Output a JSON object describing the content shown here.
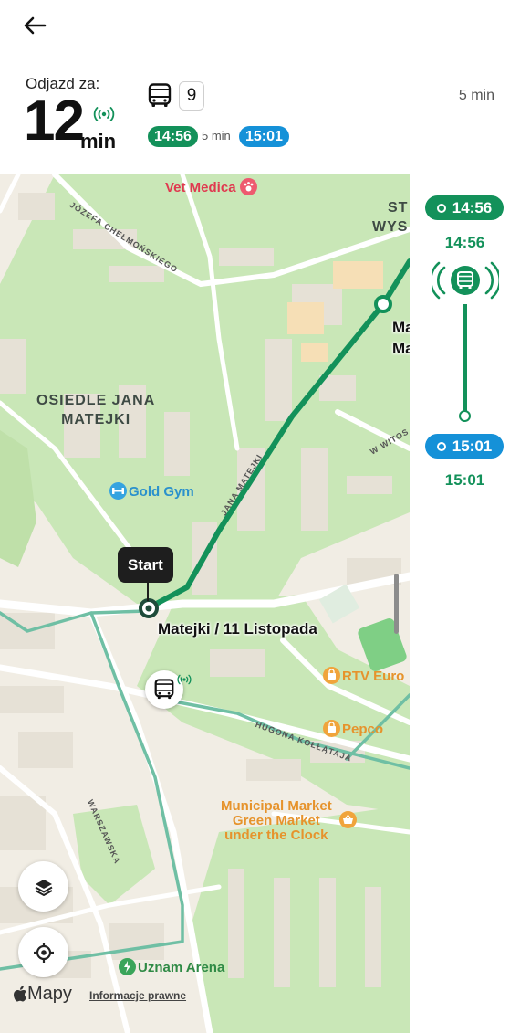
{
  "header": {
    "depart_label": "Odjazd za:",
    "depart_minutes": "12",
    "depart_unit": "min",
    "line_number": "9",
    "departure_time": "14:56",
    "duration": "5 min",
    "arrival_time": "15:01",
    "duration_right": "5 min"
  },
  "map": {
    "labels": {
      "district": "OSIEDLE JANA\nMATEJKI",
      "district_right_1": "ST\nWYS",
      "street_chelmonskiego": "JÓZEFA CHEŁMOŃSKIEGO",
      "street_matejki": "JANA MATEJKI",
      "street_witos": "W WITOS",
      "street_kollataja": "HUGONA KOŁŁĄTAJA",
      "street_warszawska": "WARSZAWSKA",
      "stop_right": "Ma\nMa",
      "poi_vet": "Vet Medica",
      "poi_gym": "Gold Gym",
      "poi_rtv": "RTV Euro",
      "poi_pepco": "Pepco",
      "poi_market": "Municipal Market\nGreen Market\nunder the Clock",
      "poi_arena": "Uznam Arena"
    },
    "start_label": "Start",
    "stop_name": "Matejki / 11 Listopada",
    "maps_brand": "Mapy",
    "legal_link": "Informacje prawne"
  },
  "timeline": {
    "departure_pill": "14:56",
    "departure_time": "14:56",
    "arrival_pill": "15:01",
    "arrival_time": "15:01"
  },
  "colors": {
    "route_green": "#13915a",
    "arrival_blue": "#1591d8",
    "park_green": "#c8e6b6",
    "transit_teal": "#6fbfa4"
  },
  "icons": [
    "back-arrow-icon",
    "live-signal-icon",
    "bus-icon",
    "layers-icon",
    "locate-icon",
    "apple-logo-icon"
  ]
}
